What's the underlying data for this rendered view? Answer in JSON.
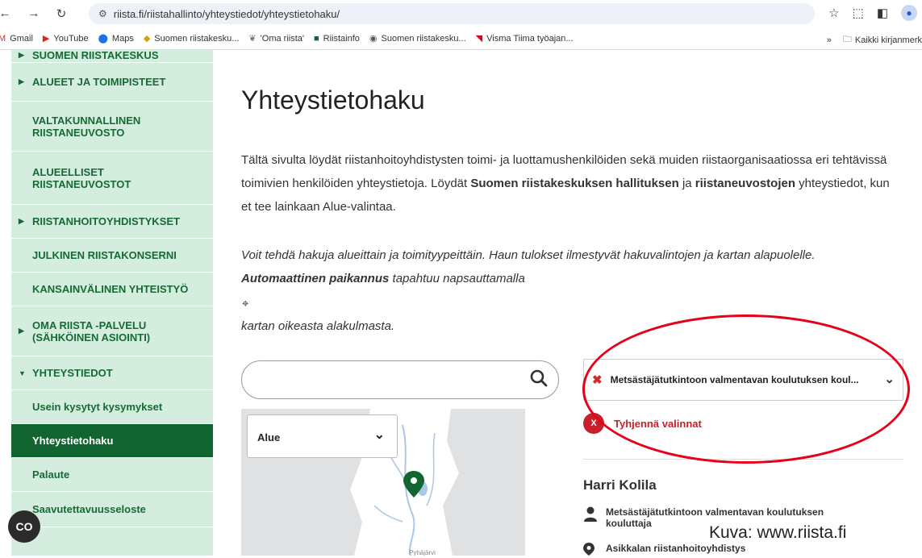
{
  "browser": {
    "url": "riista.fi/riistahallinto/yhteystiedot/yhteystietohaku/",
    "bookmarks": [
      "Gmail",
      "YouTube",
      "Maps",
      "Suomen riistakesku...",
      "'Oma riista'",
      "Riistainfo",
      "Suomen riistakesku...",
      "Visma Tiima työajan..."
    ],
    "bookmarks_more": "»",
    "all_bookmarks": "Kaikki kirjanmerk",
    "avatar_icon": "person-icon"
  },
  "sidebar": {
    "items": [
      {
        "label": "SUOMEN RIISTAKESKUS",
        "arrow": "▶"
      },
      {
        "label": "ALUEET JA TOIMIPISTEET",
        "arrow": "▶"
      },
      {
        "label": "VALTAKUNNALLINEN RIISTANEUVOSTO",
        "arrow": ""
      },
      {
        "label": "ALUEELLISET RIISTANEUVOSTOT",
        "arrow": ""
      },
      {
        "label": "RIISTANHOITOYHDISTYKSET",
        "arrow": "▶"
      },
      {
        "label": "JULKINEN RIISTAKONSERNI",
        "arrow": ""
      },
      {
        "label": "KANSAINVÄLINEN YHTEISTYÖ",
        "arrow": ""
      },
      {
        "label": "OMA RIISTA -PALVELU (SÄHKÖINEN ASIOINTI)",
        "arrow": "▶"
      },
      {
        "label": "YHTEYSTIEDOT",
        "arrow": "▼"
      },
      {
        "label": "Usein kysytyt kysymykset",
        "arrow": ""
      },
      {
        "label": "Yhteystietohaku",
        "arrow": ""
      },
      {
        "label": "Palaute",
        "arrow": ""
      },
      {
        "label": "Saavutettavuusseloste",
        "arrow": ""
      }
    ]
  },
  "main": {
    "title": "Yhteystietohaku",
    "intro_1": "Tältä sivulta löydät riistanhoitoyhdistysten toimi- ja luottamushenkilöiden sekä muiden riistaorganisaatiossa eri tehtävissä toimivien henkilöiden yhteystietoja. Löydät ",
    "intro_bold_1": "Suomen riistakeskuksen hallituksen",
    "intro_2": " ja ",
    "intro_bold_2": "riistaneuvostojen",
    "intro_3": " yhteystiedot, kun et tee lainkaan Alue-valintaa.",
    "hint_1": "Voit tehdä hakuja alueittain ja toimityypeittäin. Haun tulokset ilmestyvät hakuvalintojen ja kartan alapuolelle.",
    "hint_bold": "Automaattinen paikannus",
    "hint_2": " tapahtuu napsauttamalla",
    "hint_3": "kartan oikeasta alakulmasta.",
    "search_value": "",
    "area_label": "Alue",
    "filter_value": "Metsästäjätutkintoon valmentavan koulutuksen koul...",
    "clear_badge": "X",
    "clear_label": "Tyhjennä valinnat",
    "person_name": "Harri Kolila",
    "person_role": "Metsästäjätutkintoon valmentavan koulutuksen kouluttaja",
    "person_assoc": "Asikkalan riistanhoitoyhdistys",
    "map_label": "Pyhäjärvi"
  },
  "caption": "Kuva: www.riista.fi",
  "overlay_badge": "CO",
  "colors": {
    "sidebar_bg": "#d5eddf",
    "brand_green": "#116530",
    "clear_red": "#c8202b",
    "annotation_red": "#e6001a"
  }
}
